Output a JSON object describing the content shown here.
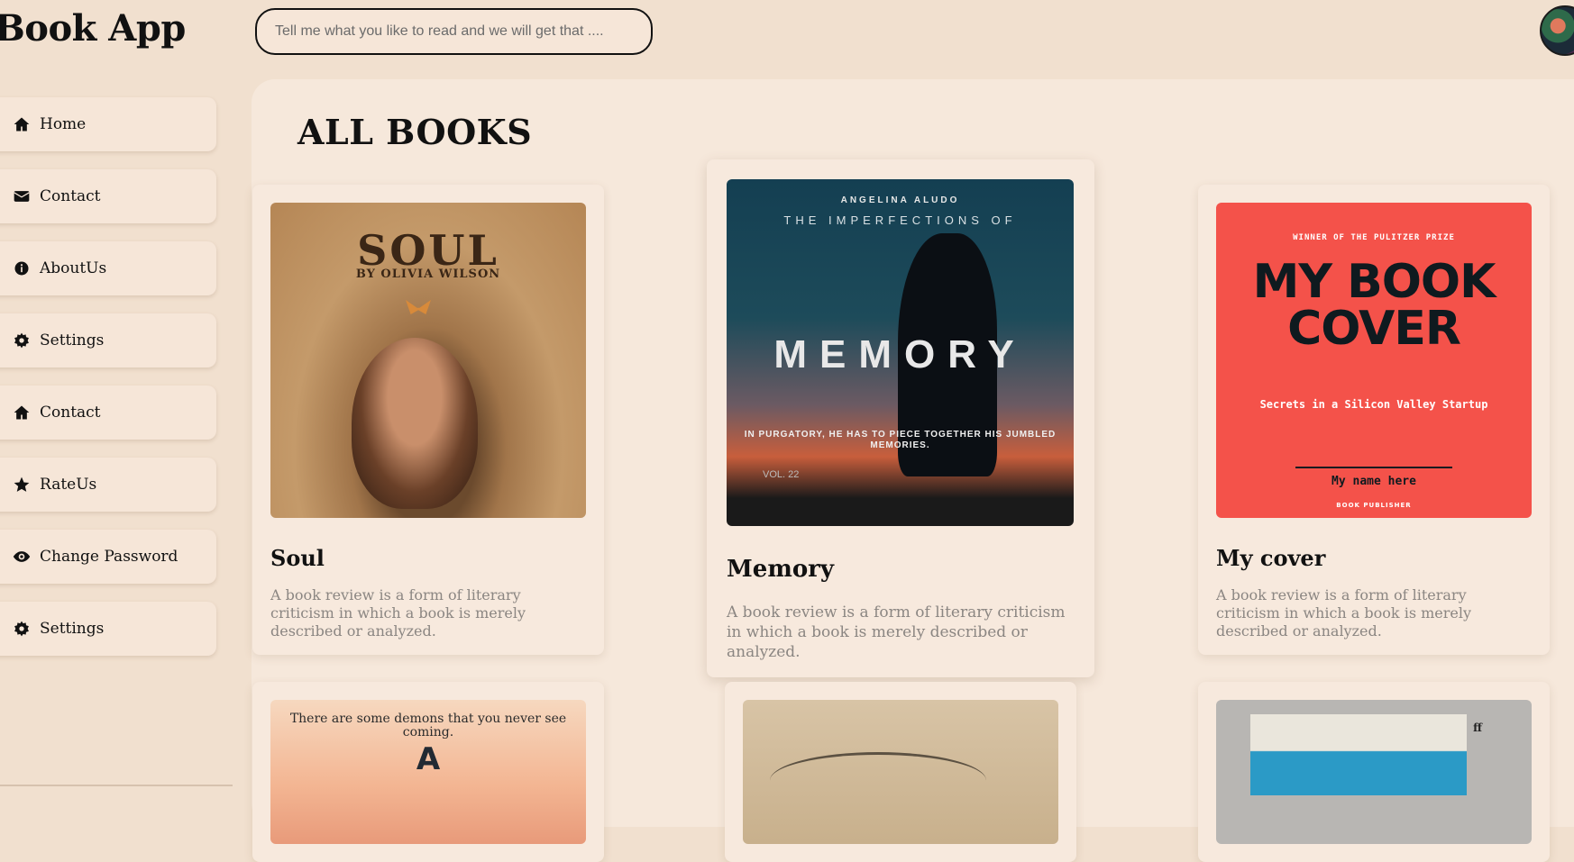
{
  "app": {
    "title": "Book App"
  },
  "search": {
    "placeholder": "Tell me what you like to read and we will get that ...."
  },
  "sidebar": {
    "items": [
      {
        "label": "Home",
        "icon": "home-icon"
      },
      {
        "label": "Contact",
        "icon": "envelope-icon"
      },
      {
        "label": "AboutUs",
        "icon": "info-icon"
      },
      {
        "label": "Settings",
        "icon": "gear-icon"
      },
      {
        "label": "Contact",
        "icon": "home-icon"
      },
      {
        "label": "RateUs",
        "icon": "star-icon"
      },
      {
        "label": "Change Password",
        "icon": "eye-icon"
      },
      {
        "label": "Settings",
        "icon": "gear-icon"
      }
    ]
  },
  "main": {
    "title": "ALL BOOKS",
    "books": [
      {
        "title": "Soul",
        "description": "A book review is a form of literary criticism in which a book is merely described or analyzed.",
        "cover_text": {
          "title": "SOUL",
          "author": "BY OLIVIA WILSON"
        }
      },
      {
        "title": "Memory",
        "description": "A book review is a form of literary criticism in which a book is merely described or analyzed.",
        "cover_text": {
          "author": "ANGELINA ALUDO",
          "pretitle": "THE IMPERFECTIONS OF",
          "title": "MEMORY",
          "tagline": "IN PURGATORY, HE HAS TO PIECE TOGETHER HIS JUMBLED MEMORIES.",
          "volume": "VOL. 22"
        }
      },
      {
        "title": "My cover",
        "description": "A book review is a form of literary criticism in which a book is merely described or analyzed.",
        "cover_text": {
          "award": "WINNER OF THE PULITZER PRIZE",
          "title": "MY BOOK COVER",
          "subtitle": "Secrets in a Silicon Valley Startup",
          "name": "My name here",
          "publisher": "BOOK PUBLISHER"
        }
      },
      {
        "cover_text": {
          "quote": "There are some demons that you never see coming.",
          "letter": "A"
        }
      },
      {
        "cover_text": {}
      },
      {
        "cover_text": {
          "logo": "ff"
        }
      }
    ]
  },
  "colors": {
    "background": "#f1e0cf",
    "panel": "#f6e8db",
    "card": "#f7e9dd",
    "description_text": "#8b8682"
  }
}
